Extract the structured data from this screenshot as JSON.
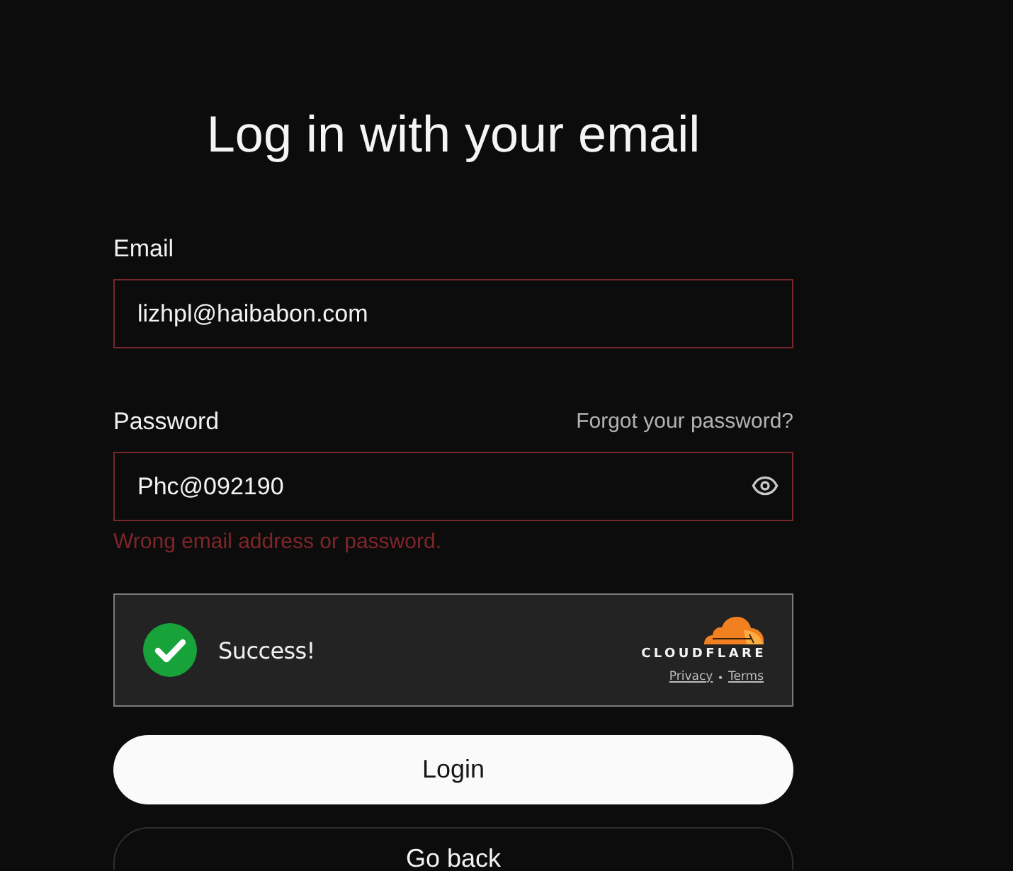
{
  "title": "Log in with your email",
  "email": {
    "label": "Email",
    "value": "lizhpl@haibabon.com",
    "invalid": true
  },
  "password": {
    "label": "Password",
    "value": "Phc@092190",
    "forgot_link": "Forgot your password?",
    "invalid": true
  },
  "error": "Wrong email address or password.",
  "captcha": {
    "verified": true,
    "message": "Success!",
    "brand": "CLOUDFLARE",
    "links": [
      "Privacy",
      "Terms"
    ],
    "separator": "•"
  },
  "buttons": [
    {
      "label": "Login",
      "kind": "primary"
    },
    {
      "label": "Go back",
      "kind": "secondary"
    }
  ]
}
